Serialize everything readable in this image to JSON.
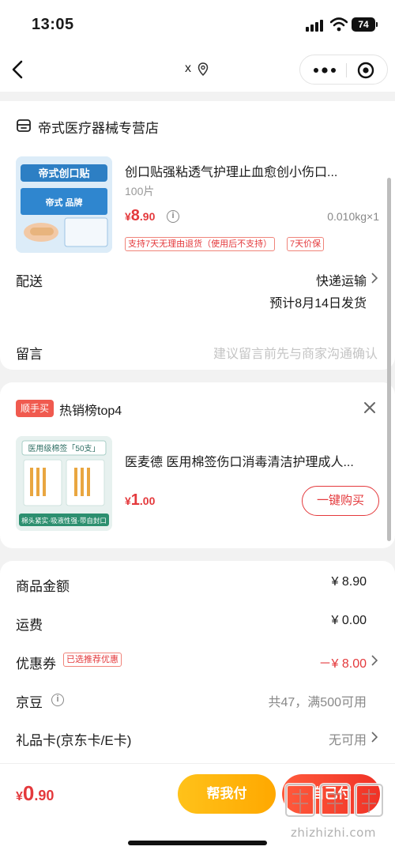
{
  "status_bar": {
    "time": "13:05",
    "battery": "74"
  },
  "nav": {
    "title": "x"
  },
  "store": {
    "name": "帝式医疗器械专营店",
    "product": {
      "title": "创口贴强粘透气护理止血愈创小伤口...",
      "spec": "100片",
      "price_currency": "¥",
      "price_int": "8",
      "price_dec": ".90",
      "weight_qty": "0.010kg×1",
      "tags": [
        "支持7天无理由退货（使用后不支持）",
        "7天价保"
      ],
      "image_text": {
        "brand": "帝式创口贴",
        "line2": "帝式 品牌"
      }
    }
  },
  "delivery": {
    "label": "配送",
    "method": "快递运输",
    "eta": "预计8月14日发货"
  },
  "message": {
    "label": "留言",
    "placeholder": "建议留言前先与商家沟通确认"
  },
  "recommend": {
    "badge": "顺手买",
    "title": "热销榜top4",
    "product": "医麦德 医用棉签伤口消毒清洁护理成人...",
    "price_currency": "¥",
    "price_int": "1",
    "price_dec": ".00",
    "buy_label": "一键购买",
    "image_text": {
      "top": "医用级棉签「50支」",
      "bottom": "棉头紧实·吸液性强·带自封口"
    }
  },
  "summary": {
    "goods_label": "商品金额",
    "goods_value": "¥ 8.90",
    "shipping_label": "运费",
    "shipping_value": "¥ 0.00",
    "coupon_label": "优惠券",
    "coupon_tag": "已选推荐优惠",
    "coupon_value": "－¥ 8.00",
    "jingdou_label": "京豆",
    "jingdou_value": "共47，满500可用",
    "giftcard_label": "礼品卡(京东卡/E卡)",
    "giftcard_value": "无可用"
  },
  "bottom_bar": {
    "total_currency": "¥",
    "total_int": "0",
    "total_dec": ".90",
    "help_pay_label": "帮我付",
    "pay_label": "自己付"
  },
  "watermark": {
    "text": "zhizhizhi.com"
  },
  "colors": {
    "accent_red": "#e4393c",
    "help_yellow": "#ffb400"
  }
}
